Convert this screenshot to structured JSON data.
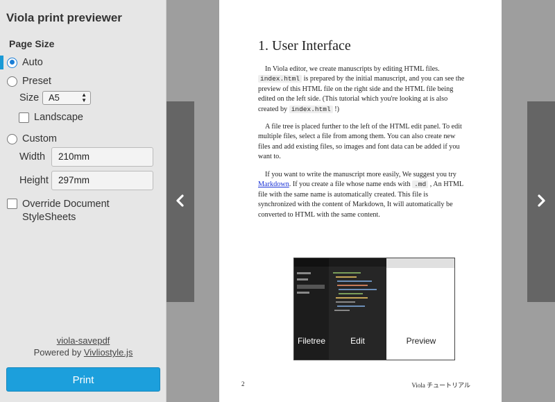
{
  "app_title": "Viola print previewer",
  "page_size": {
    "heading": "Page Size",
    "options": {
      "auto": "Auto",
      "preset": "Preset",
      "custom": "Custom"
    },
    "selected": "Auto",
    "size_label": "Size",
    "size_value": "A5",
    "landscape_label": "Landscape",
    "width_label": "Width",
    "width_value": "210mm",
    "height_label": "Height",
    "height_value": "297mm"
  },
  "override": {
    "line1": "Override Document",
    "line2": "StyleSheets"
  },
  "footer": {
    "savepdf_link": "viola-savepdf",
    "powered_prefix": "Powered by ",
    "powered_link": "Vivliostyle.js"
  },
  "print_button": "Print",
  "nav": {
    "prev_icon": "chevron-left-icon",
    "next_icon": "chevron-right-icon"
  },
  "page": {
    "title": "1. User Interface",
    "p1": {
      "t1": "In Viola editor, we create manuscripts by editing HTML files. ",
      "code1": "index.html",
      "t2": " is prepared by the initial manuscript, and you can see the preview of this HTML file on the right side and the HTML file being edited on the left side. (This tutorial which you're looking at is also created by ",
      "code2": "index.html",
      "t3": " !)"
    },
    "p2": "A file tree is placed further to the left of the HTML edit panel. To edit multiple files, select a file from among them. You can also create new files and add existing files, so images and font data can be added if you want to.",
    "p3": {
      "t1": "If you want to write the manuscript more easily, We suggest you try ",
      "link": "Markdown",
      "t2": ". If you create a file whose name ends with ",
      "code": ".md",
      "t3": " , An HTML file with the same name is automatically created. This file is synchronized with the content of Markdown, It will automatically be converted to HTML with the same content."
    },
    "figure": {
      "filetree": "Filetree",
      "edit": "Edit",
      "preview": "Preview"
    },
    "page_number": "2",
    "running_footer": "Viola チュートリアル"
  },
  "colors": {
    "accent": "#1c9fdc",
    "sidebar_bg": "#e6e6e6",
    "viewer_bg": "#9e9e9e",
    "nav_bg": "#656565"
  }
}
